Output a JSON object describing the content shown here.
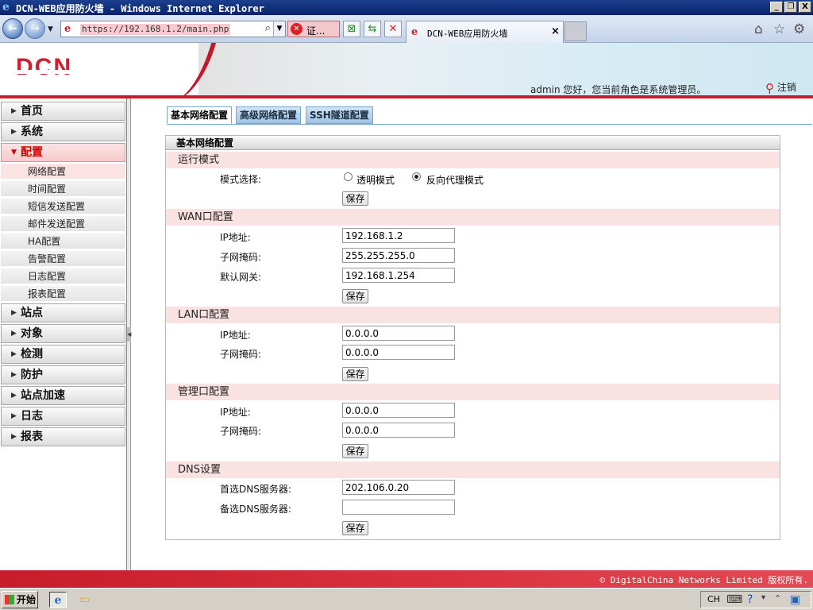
{
  "window": {
    "title": "DCN-WEB应用防火墙 - Windows Internet Explorer",
    "minimize": "_",
    "restore": "❐",
    "close": "X"
  },
  "browser": {
    "url": "https://192.168.1.2/main.php",
    "cert_error": "证...",
    "tab_title": "DCN-WEB应用防火墙",
    "tab_close": "×"
  },
  "header": {
    "logo": "DCN",
    "welcome": "admin 您好，您当前角色是系统管理员。",
    "logout": "注销"
  },
  "sidebar": {
    "items": [
      {
        "label": "首页"
      },
      {
        "label": "系统"
      },
      {
        "label": "配置"
      },
      {
        "label": "站点"
      },
      {
        "label": "对象"
      },
      {
        "label": "检测"
      },
      {
        "label": "防护"
      },
      {
        "label": "站点加速"
      },
      {
        "label": "日志"
      },
      {
        "label": "报表"
      }
    ],
    "config_children": [
      {
        "label": "网络配置"
      },
      {
        "label": "时间配置"
      },
      {
        "label": "短信发送配置"
      },
      {
        "label": "邮件发送配置"
      },
      {
        "label": "HA配置"
      },
      {
        "label": "告警配置"
      },
      {
        "label": "日志配置"
      },
      {
        "label": "报表配置"
      }
    ]
  },
  "tabs": [
    {
      "label": "基本网络配置"
    },
    {
      "label": "高级网络配置"
    },
    {
      "label": "SSH隧道配置"
    }
  ],
  "panel": {
    "title": "基本网络配置",
    "save_label": "保存",
    "run_mode": {
      "section": "运行模式",
      "label": "模式选择:",
      "transparent": "透明模式",
      "reverse_proxy": "反向代理模式",
      "selected": "反向代理模式"
    },
    "wan": {
      "section": "WAN口配置",
      "ip_label": "IP地址:",
      "ip": "192.168.1.2",
      "mask_label": "子网掩码:",
      "mask": "255.255.255.0",
      "gw_label": "默认网关:",
      "gw": "192.168.1.254"
    },
    "lan": {
      "section": "LAN口配置",
      "ip_label": "IP地址:",
      "ip": "0.0.0.0",
      "mask_label": "子网掩码:",
      "mask": "0.0.0.0"
    },
    "mgmt": {
      "section": "管理口配置",
      "ip_label": "IP地址:",
      "ip": "0.0.0.0",
      "mask_label": "子网掩码:",
      "mask": "0.0.0.0"
    },
    "dns": {
      "section": "DNS设置",
      "primary_label": "首选DNS服务器:",
      "primary": "202.106.0.20",
      "secondary_label": "备选DNS服务器:",
      "secondary": ""
    }
  },
  "footer": {
    "copyright": "© DigitalChina Networks Limited 版权所有."
  },
  "taskbar": {
    "start": "开始",
    "lang": "CH"
  },
  "colors": {
    "brand_red": "#c71c2a",
    "section_bg": "#fbe2e2",
    "tab_blue": "#9ec4e6"
  }
}
